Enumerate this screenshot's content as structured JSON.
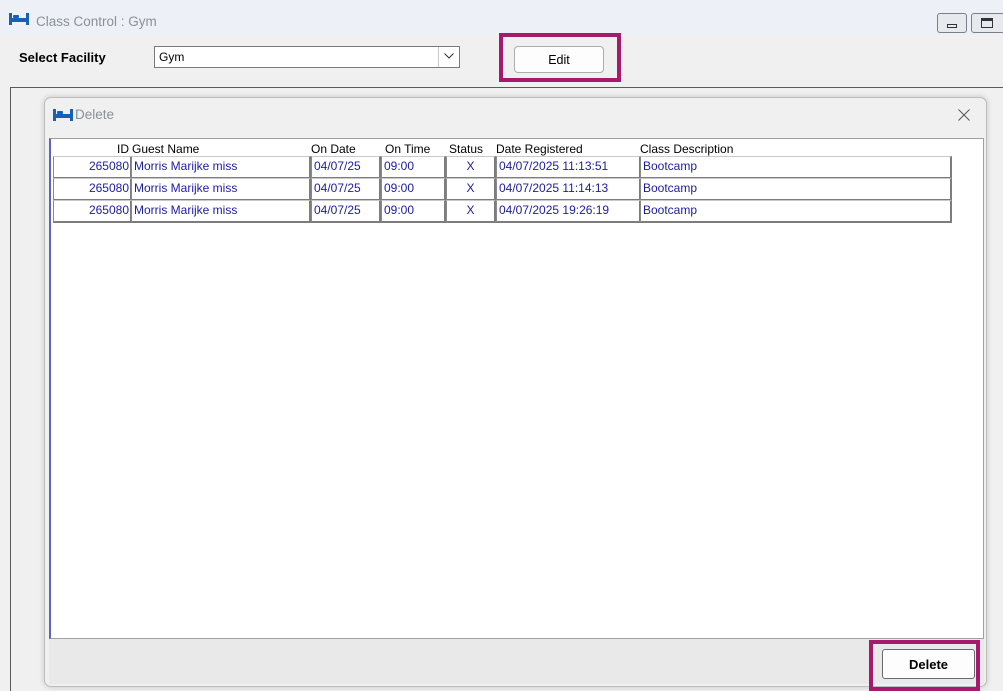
{
  "window": {
    "title": "Class Control : Gym",
    "icon": "bed-icon"
  },
  "facility": {
    "label": "Select Facility",
    "value": "Gym"
  },
  "toolbar": {
    "edit_label": "Edit"
  },
  "dialog": {
    "title": "Delete",
    "icon": "bed-icon",
    "columns": {
      "id": "ID",
      "guest_name": "Guest Name",
      "on_date": "On Date",
      "on_time": "On Time",
      "status": "Status",
      "date_registered": "Date Registered",
      "class_description": "Class Description"
    },
    "rows": [
      {
        "id": "265080",
        "guest_name": "Morris Marijke miss",
        "on_date": "04/07/25",
        "on_time": "09:00",
        "status": "X",
        "date_registered": "04/07/2025 11:13:51",
        "class_description": "Bootcamp"
      },
      {
        "id": "265080",
        "guest_name": "Morris Marijke miss",
        "on_date": "04/07/25",
        "on_time": "09:00",
        "status": "X",
        "date_registered": "04/07/2025 11:14:13",
        "class_description": "Bootcamp"
      },
      {
        "id": "265080",
        "guest_name": "Morris Marijke miss",
        "on_date": "04/07/25",
        "on_time": "09:00",
        "status": "X",
        "date_registered": "04/07/2025 19:26:19",
        "class_description": "Bootcamp"
      }
    ],
    "delete_label": "Delete"
  },
  "colors": {
    "highlight": "#a61a6e",
    "cell_text": "#1c1ca0",
    "icon": "#1a5fb4"
  }
}
